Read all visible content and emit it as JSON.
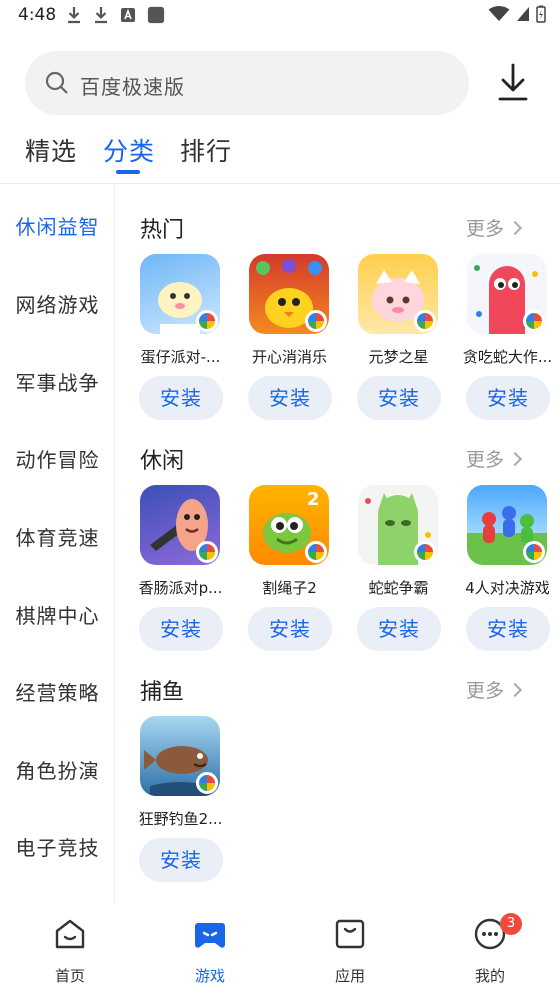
{
  "status_bar": {
    "time": "4:48"
  },
  "search": {
    "placeholder": "百度极速版"
  },
  "top_tabs": [
    {
      "label": "精选",
      "active": false
    },
    {
      "label": "分类",
      "active": true
    },
    {
      "label": "排行",
      "active": false
    }
  ],
  "sidebar": {
    "items": [
      {
        "label": "休闲益智",
        "active": true
      },
      {
        "label": "网络游戏"
      },
      {
        "label": "军事战争"
      },
      {
        "label": "动作冒险"
      },
      {
        "label": "体育竞速"
      },
      {
        "label": "棋牌中心"
      },
      {
        "label": "经营策略"
      },
      {
        "label": "角色扮演"
      },
      {
        "label": "电子竞技"
      }
    ]
  },
  "sections": [
    {
      "title": "热门",
      "more": "更多",
      "apps": [
        {
          "name": "蛋仔派对-...",
          "install": "安装",
          "icon": "eggy-party-icon"
        },
        {
          "name": "开心消消乐",
          "install": "安装",
          "icon": "happy-match-icon"
        },
        {
          "name": "元梦之星",
          "install": "安装",
          "icon": "dream-star-icon"
        },
        {
          "name": "贪吃蛇大作...",
          "install": "安装",
          "icon": "snake-battle-icon"
        }
      ]
    },
    {
      "title": "休闲",
      "more": "更多",
      "apps": [
        {
          "name": "香肠派对p...",
          "install": "安装",
          "icon": "sausage-party-icon"
        },
        {
          "name": "割绳子2",
          "install": "安装",
          "icon": "cut-the-rope-icon"
        },
        {
          "name": "蛇蛇争霸",
          "install": "安装",
          "icon": "snake-war-icon"
        },
        {
          "name": "4人对决游戏",
          "install": "安装",
          "icon": "four-player-icon"
        }
      ]
    },
    {
      "title": "捕鱼",
      "more": "更多",
      "apps": [
        {
          "name": "狂野钓鱼2...",
          "install": "安装",
          "icon": "wild-fishing-icon"
        }
      ]
    }
  ],
  "bottom_nav": [
    {
      "label": "首页",
      "icon": "home-icon"
    },
    {
      "label": "游戏",
      "icon": "gamepad-icon",
      "active": true
    },
    {
      "label": "应用",
      "icon": "apps-bag-icon"
    },
    {
      "label": "我的",
      "icon": "profile-icon",
      "badge": "3"
    }
  ],
  "colors": {
    "accent": "#1a66e8",
    "install_bg": "#e9eef7",
    "badge": "#ef4b3c"
  }
}
